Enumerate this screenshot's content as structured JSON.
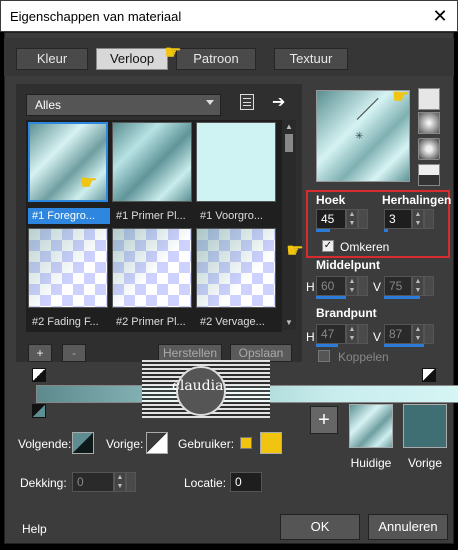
{
  "window": {
    "title": "Eigenschappen van materiaal"
  },
  "tabs": [
    {
      "label": "Kleur"
    },
    {
      "label": "Verloop"
    },
    {
      "label": "Patroon"
    },
    {
      "label": "Textuur"
    }
  ],
  "gallery": {
    "category": "Alles",
    "items": [
      {
        "label": "#1 Foregro..."
      },
      {
        "label": "#1 Primer Pl..."
      },
      {
        "label": "#1 Voorgro..."
      },
      {
        "label": "#2 Fading F..."
      },
      {
        "label": "#2 Primer Pl..."
      },
      {
        "label": "#2 Vervage..."
      }
    ],
    "add_label": "+",
    "remove_label": "-",
    "restore_label": "Herstellen",
    "save_label": "Opslaan"
  },
  "settings": {
    "angle_label": "Hoek",
    "angle_value": "45",
    "repeats_label": "Herhalingen",
    "repeats_value": "3",
    "invert_label": "Omkeren",
    "center_label": "Middelpunt",
    "center_h_label": "H",
    "center_h": "60",
    "center_v_label": "V",
    "center_v": "75",
    "focal_label": "Brandpunt",
    "focal_h_label": "H",
    "focal_h": "47",
    "focal_v_label": "V",
    "focal_v": "87",
    "link_label": "Koppelen"
  },
  "bottom": {
    "following_label": "Volgende:",
    "previous_label": "Vorige:",
    "user_label": "Gebruiker:",
    "opacity_label": "Dekking:",
    "opacity_value": "0",
    "location_label": "Locatie:",
    "location_value": "0",
    "current_label": "Huidige",
    "previous_swatch_label": "Vorige"
  },
  "footer": {
    "help_label": "Help",
    "ok_label": "OK",
    "cancel_label": "Annuleren"
  },
  "watermark": {
    "text": "claudia"
  },
  "colors": {
    "accent": "#2d7bd8",
    "highlight_box": "#d92b2b",
    "previous_swatch": "#3f6f72",
    "user_color": "#f1c40f"
  }
}
